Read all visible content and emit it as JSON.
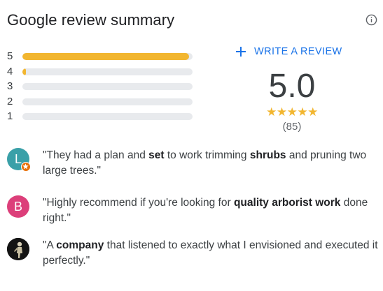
{
  "header": {
    "title": "Google review summary",
    "info_icon": "info-icon"
  },
  "distribution": [
    {
      "stars": "5",
      "fraction": 0.98
    },
    {
      "stars": "4",
      "fraction": 0.02
    },
    {
      "stars": "3",
      "fraction": 0.0
    },
    {
      "stars": "2",
      "fraction": 0.0
    },
    {
      "stars": "1",
      "fraction": 0.0
    }
  ],
  "summary": {
    "write_review_label": "WRITE A REVIEW",
    "write_review_icon": "plus-icon",
    "rating": "5.0",
    "stars": "★★★★★",
    "review_count": "(85)"
  },
  "reviews": [
    {
      "avatar_letter": "L",
      "avatar_color": "#3aa0a8",
      "has_badge": true,
      "parts": [
        {
          "t": "\"They had a plan and ",
          "b": false
        },
        {
          "t": "set",
          "b": true
        },
        {
          "t": " to work trimming ",
          "b": false
        },
        {
          "t": "shrubs",
          "b": true
        },
        {
          "t": " and pruning two large trees.\"",
          "b": false
        }
      ]
    },
    {
      "avatar_letter": "B",
      "avatar_color": "#dc3f7a",
      "has_badge": false,
      "parts": [
        {
          "t": "\"Highly recommend if you're looking for ",
          "b": false
        },
        {
          "t": "quality arborist work",
          "b": true
        },
        {
          "t": " done right.\"",
          "b": false
        }
      ]
    },
    {
      "avatar_letter": "",
      "avatar_color": "#1a1a1a",
      "has_badge": false,
      "parts": [
        {
          "t": "\"A ",
          "b": false
        },
        {
          "t": "company",
          "b": true
        },
        {
          "t": " that listened to exactly what I envisioned and executed it perfectly.\"",
          "b": false
        }
      ]
    }
  ],
  "colors": {
    "bar_fill": "#f2b630",
    "bar_track": "#e8eaed",
    "link": "#1a73e8"
  }
}
